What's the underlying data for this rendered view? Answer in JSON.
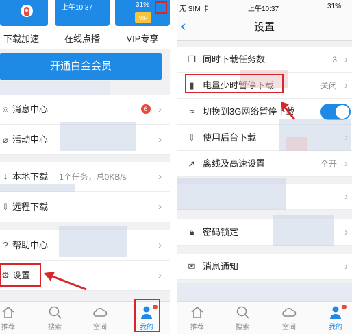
{
  "left": {
    "top_tiles": [
      {
        "label": "下载加速"
      },
      {
        "label": "在线点播"
      },
      {
        "label": "VIP专享"
      }
    ],
    "status_time": "上午10:37",
    "status_battery": "31%",
    "member_button": "开通白金会员",
    "menu": [
      {
        "label": "消息中心",
        "icon": "message-icon",
        "badge": "6"
      },
      {
        "label": "活动中心",
        "icon": "tag-icon"
      },
      {
        "label": "本地下载",
        "icon": "download-icon",
        "sub": "1个任务，总0KB/s"
      },
      {
        "label": "远程下载",
        "icon": "remote-download-icon"
      },
      {
        "label": "帮助中心",
        "icon": "help-icon"
      },
      {
        "label": "设置",
        "icon": "gear-icon"
      }
    ],
    "tabs": [
      {
        "label": "推荐",
        "icon": "home-icon"
      },
      {
        "label": "搜索",
        "icon": "search-icon"
      },
      {
        "label": "空间",
        "icon": "cloud-icon"
      },
      {
        "label": "我的",
        "icon": "person-icon",
        "active": true
      }
    ]
  },
  "right": {
    "status": {
      "carrier": "无 SIM 卡",
      "time": "上午10:37",
      "battery": "31%"
    },
    "title": "设置",
    "rows": [
      {
        "label": "同时下载任务数",
        "icon": "copy-icon",
        "value": "3"
      },
      {
        "label": "电量少时暂停下载",
        "icon": "battery-icon",
        "value": "关闭"
      },
      {
        "label": "切换到3G网络暂停下载",
        "icon": "wifi-icon",
        "toggle": true
      },
      {
        "label": "使用后台下载",
        "icon": "download-icon"
      },
      {
        "label": "离线及高速设置",
        "icon": "rocket-icon",
        "value": "全开"
      },
      {
        "label": "密码锁定",
        "icon": "lock-icon"
      },
      {
        "label": "消息通知",
        "icon": "mail-icon"
      }
    ],
    "tabs": [
      {
        "label": "推荐",
        "icon": "home-icon"
      },
      {
        "label": "搜索",
        "icon": "search-icon"
      },
      {
        "label": "空间",
        "icon": "cloud-icon"
      },
      {
        "label": "我的",
        "icon": "person-icon",
        "active": true
      }
    ]
  },
  "colors": {
    "accent": "#1e8ae6",
    "highlight": "#d9262b",
    "badge": "#e84a3c"
  }
}
